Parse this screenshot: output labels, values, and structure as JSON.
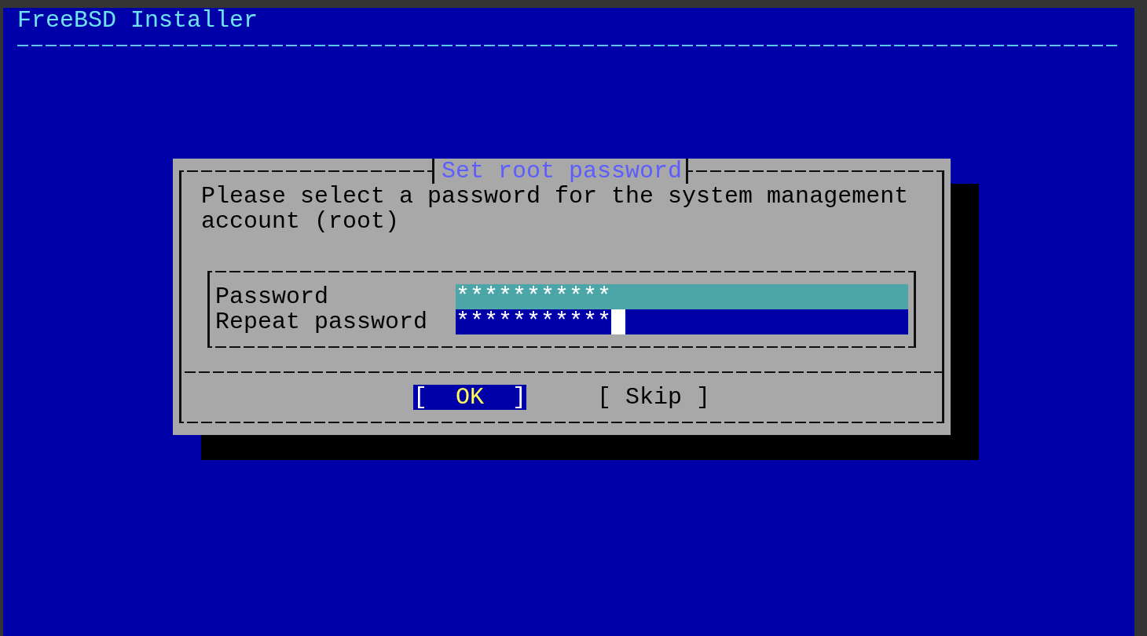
{
  "header": {
    "title": "FreeBSD Installer"
  },
  "dialog": {
    "title": "Set root password",
    "message": "Please select a password for the system management account (root)",
    "fields": [
      {
        "label": "Password",
        "value": "***********",
        "focused": false
      },
      {
        "label": "Repeat password",
        "value": "***********",
        "focused": true
      }
    ],
    "buttons": [
      {
        "label": "[  OK  ]",
        "selected": true
      },
      {
        "label": "[ Skip ]",
        "selected": false
      }
    ]
  }
}
